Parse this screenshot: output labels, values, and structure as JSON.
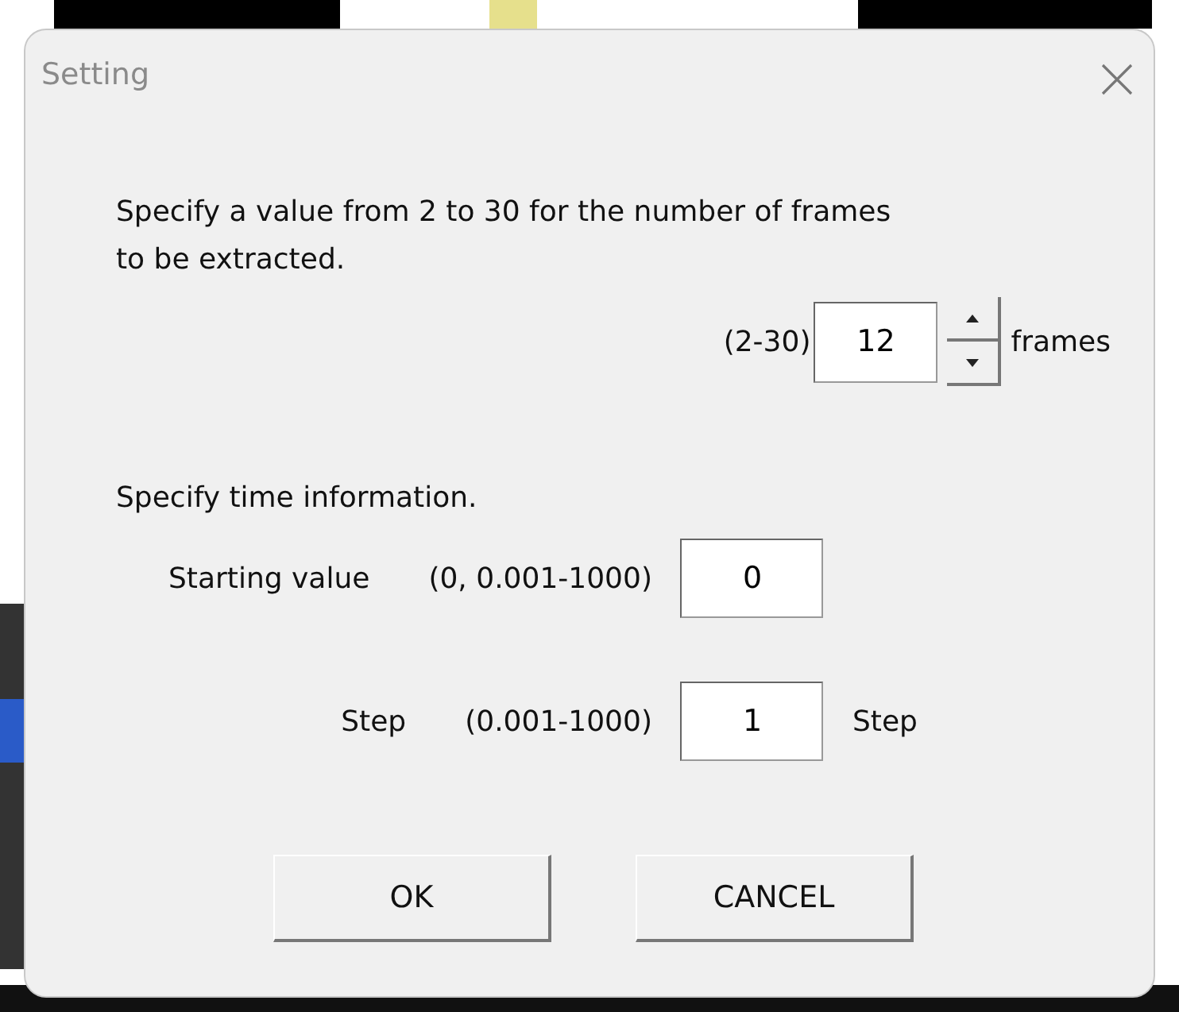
{
  "dialog": {
    "title": "Setting"
  },
  "frames": {
    "instruction": "Specify a value from 2 to 30 for the number of frames to be extracted.",
    "range": "(2-30)",
    "value": "12",
    "unit": "frames"
  },
  "time": {
    "instruction": "Specify time information.",
    "fields": [
      {
        "label": "Starting value",
        "range": "(0, 0.001-1000)",
        "value": "0"
      },
      {
        "label": "Step",
        "range": "(0.001-1000)",
        "value": "1",
        "unit": "Step"
      }
    ]
  },
  "buttons": [
    "OK",
    "CANCEL"
  ]
}
